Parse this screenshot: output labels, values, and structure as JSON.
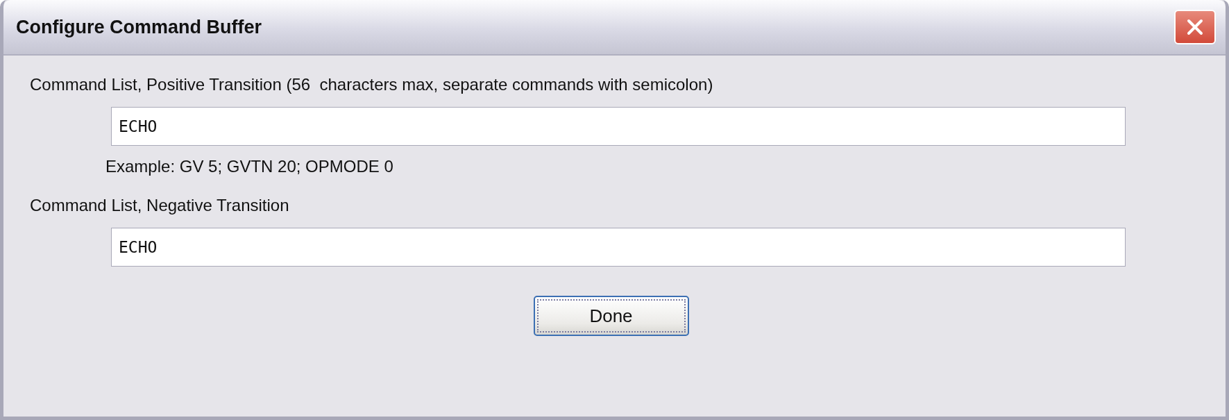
{
  "window": {
    "title": "Configure Command Buffer"
  },
  "fields": [
    {
      "label": "Command List, Positive Transition (56  characters max, separate commands with semicolon)",
      "value": "ECHO",
      "hint": "Example: GV 5; GVTN 20; OPMODE 0"
    },
    {
      "label": "Command List, Negative Transition",
      "value": "ECHO"
    }
  ],
  "buttons": [
    {
      "label": "Done",
      "focused": true
    }
  ]
}
